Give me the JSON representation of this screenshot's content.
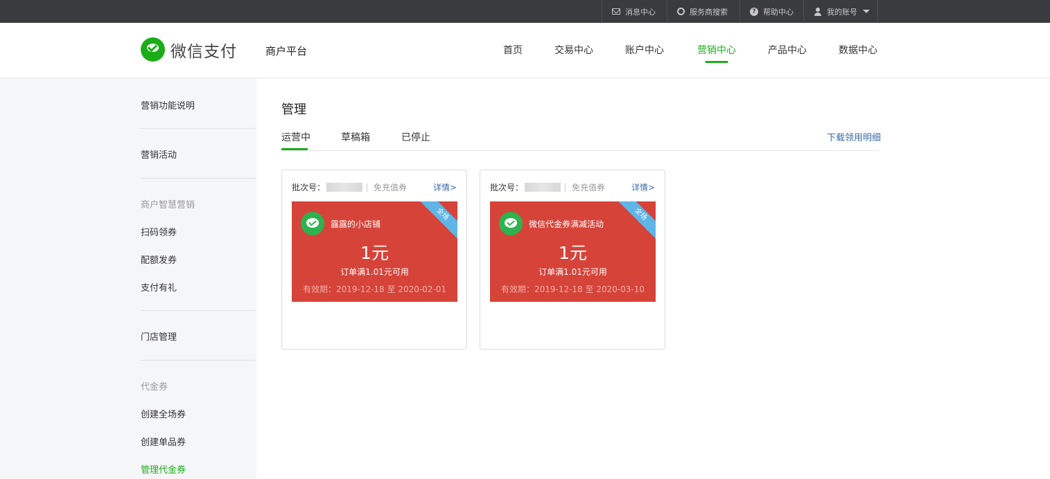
{
  "topbar": {
    "items": [
      {
        "label": "消息中心",
        "icon": "mail-icon"
      },
      {
        "label": "服务商搜索",
        "icon": "search-icon"
      },
      {
        "label": "帮助中心",
        "icon": "help-icon"
      },
      {
        "label": "我的账号",
        "icon": "user-icon"
      }
    ]
  },
  "header": {
    "logo_text": "微信支付",
    "platform": "商户平台",
    "nav": [
      {
        "label": "首页"
      },
      {
        "label": "交易中心"
      },
      {
        "label": "账户中心"
      },
      {
        "label": "营销中心",
        "active": true
      },
      {
        "label": "产品中心"
      },
      {
        "label": "数据中心"
      }
    ]
  },
  "sidebar": {
    "items": [
      {
        "label": "营销功能说明"
      },
      {
        "label": "营销活动"
      },
      {
        "label": "商户智慧营销",
        "group": true
      },
      {
        "label": "扫码领券"
      },
      {
        "label": "配额发券"
      },
      {
        "label": "支付有礼"
      },
      {
        "label": "门店管理"
      },
      {
        "label": "代金券",
        "group": true
      },
      {
        "label": "创建全场券"
      },
      {
        "label": "创建单品券"
      },
      {
        "label": "管理代金券",
        "active": true
      }
    ]
  },
  "main": {
    "title": "管理",
    "tabs": [
      {
        "label": "运营中",
        "active": true
      },
      {
        "label": "草稿箱"
      },
      {
        "label": "已停止"
      }
    ],
    "download_link": "下载领用明细",
    "cards": [
      {
        "batch_label": "批次号：",
        "coupon_type": "免充值券",
        "detail_link": "详情>",
        "store_name": "露露的小店铺",
        "amount": "1元",
        "condition": "订单满1.01元可用",
        "validity": "有效期：2019-12-18 至 2020-02-01",
        "ribbon": "全场"
      },
      {
        "batch_label": "批次号：",
        "coupon_type": "免充值券",
        "detail_link": "详情>",
        "store_name": "微信代金券满减活动",
        "amount": "1元",
        "condition": "订单满1.01元可用",
        "validity": "有效期：2019-12-18 至 2020-03-10",
        "ribbon": "全场"
      }
    ]
  },
  "colors": {
    "accent": "#1aad19",
    "topbar": "#3a3b3f",
    "coupon": "#d54339",
    "ribbon": "#5fb5e6",
    "link": "#3a6aa8"
  }
}
